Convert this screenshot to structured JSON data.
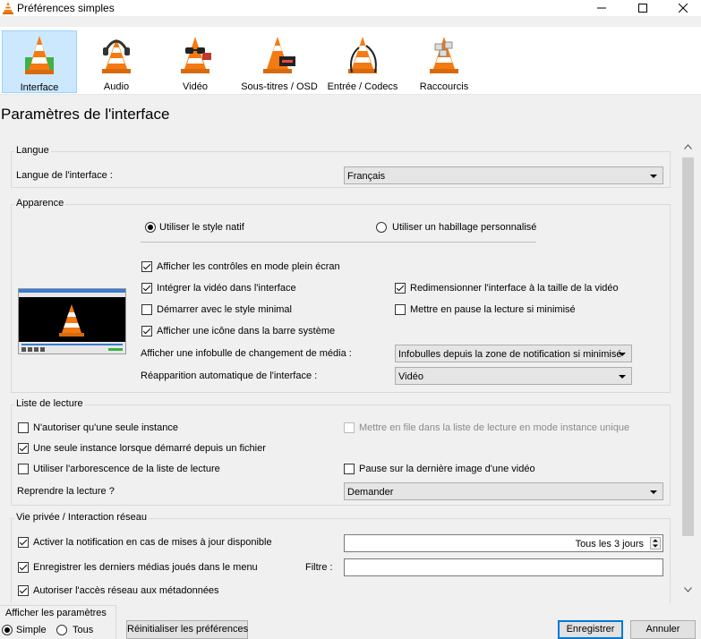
{
  "window": {
    "title": "Préférences simples"
  },
  "categories": [
    {
      "label": "Interface",
      "selected": true
    },
    {
      "label": "Audio",
      "selected": false
    },
    {
      "label": "Vidéo",
      "selected": false
    },
    {
      "label": "Sous-titres / OSD",
      "selected": false
    },
    {
      "label": "Entrée / Codecs",
      "selected": false
    },
    {
      "label": "Raccourcis",
      "selected": false
    }
  ],
  "page_title": "Paramètres de l'interface",
  "langue": {
    "legend": "Langue",
    "label": "Langue de l'interface :",
    "value": "Français"
  },
  "apparence": {
    "legend": "Apparence",
    "radio_native": "Utiliser le style natif",
    "radio_custom": "Utiliser un habillage personnalisé",
    "fullscreen_controls": "Afficher les contrôles en mode plein écran",
    "embed_video": "Intégrer la vidéo dans l'interface",
    "resize_interface": "Redimensionner l'interface à la taille de la vidéo",
    "minimal_style": "Démarrer avec le style minimal",
    "pause_minimized": "Mettre en pause la lecture si minimisé",
    "systray_icon": "Afficher une icône dans la barre système",
    "tooltip_label": "Afficher une infobulle de changement de média :",
    "tooltip_value": "Infobulles depuis la zone de notification si minimisé",
    "autoraise_label": "Réapparition automatique de l'interface :",
    "autoraise_value": "Vidéo"
  },
  "playlist": {
    "legend": "Liste de lecture",
    "one_instance": "N'autoriser qu'une seule instance",
    "enqueue": "Mettre en file dans la liste de lecture en mode instance unique",
    "one_instance_file": "Une seule instance lorsque démarré depuis un fichier",
    "tree": "Utiliser l'arborescence de la liste de lecture",
    "pause_last_frame": "Pause sur la dernière image d'une vidéo",
    "resume_label": "Reprendre la lecture ?",
    "resume_value": "Demander"
  },
  "privacy": {
    "legend": "Vie privée / Interaction réseau",
    "update_notify": "Activer la notification en cas de mises à jour disponible",
    "update_value": "Tous les 3 jours",
    "recent_media": "Enregistrer les derniers médias joués dans le menu",
    "filter_label": "Filtre :",
    "filter_value": "",
    "metadata_access": "Autoriser l'accès réseau aux métadonnées"
  },
  "footer": {
    "show_settings": "Afficher les paramètres",
    "simple": "Simple",
    "all": "Tous",
    "reset": "Réinitialiser les préférences",
    "save": "Enregistrer",
    "cancel": "Annuler"
  },
  "colors": {
    "selection_bg": "#cce8ff",
    "selection_border": "#99d1ff",
    "cone_orange": "#f47a12",
    "default_button_border": "#0078d7"
  },
  "icons": [
    "vlc-cone-icon",
    "minimize-icon",
    "maximize-icon",
    "close-icon",
    "chevron-up-icon",
    "chevron-down-icon"
  ]
}
